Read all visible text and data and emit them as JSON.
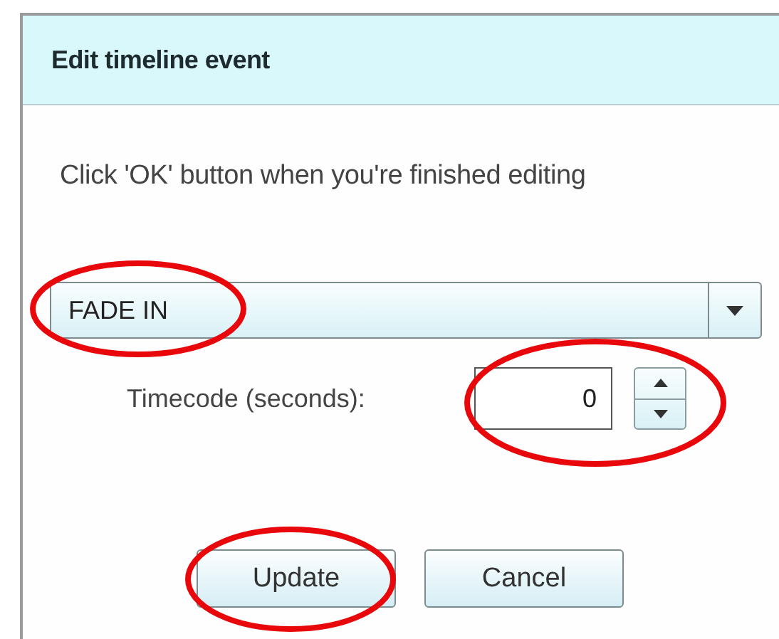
{
  "dialog": {
    "title": "Edit timeline event",
    "message": "Click 'OK' button when you're finished editing",
    "event_type": {
      "value": "FADE IN"
    },
    "timecode": {
      "label": "Timecode (seconds):",
      "value": "0"
    },
    "buttons": [
      {
        "label": "Update"
      },
      {
        "label": "Cancel"
      }
    ]
  }
}
